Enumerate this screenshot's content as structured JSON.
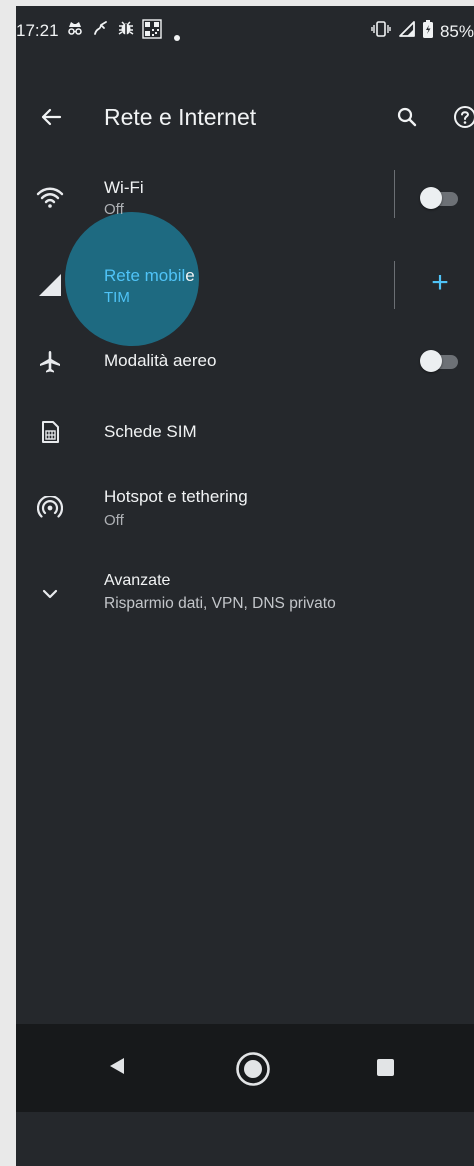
{
  "status_bar": {
    "time": "17:21",
    "battery_text": "85%",
    "left_icons": [
      "incognito-icon",
      "call-forward-icon",
      "bug-icon",
      "qr-icon",
      "dot-icon"
    ],
    "right_icons": [
      "vibrate-icon",
      "signal-icon",
      "battery-icon"
    ]
  },
  "app_bar": {
    "title": "Rete e Internet",
    "icons": [
      "back-arrow-icon",
      "search-icon",
      "help-icon"
    ]
  },
  "settings": [
    {
      "id": "wifi",
      "title": "Wi-Fi",
      "subtitle": "Off",
      "icon": "wifi-icon",
      "control": "toggle",
      "toggle_on": false
    },
    {
      "id": "mobile",
      "title_highlight": "Rete mobil",
      "title_rest": "e",
      "subtitle": "TIM",
      "icon": "cell-signal-icon",
      "control": "add",
      "control_text": "+"
    },
    {
      "id": "airplane",
      "title": "Modalità aereo",
      "icon": "airplane-icon",
      "control": "toggle",
      "toggle_on": false
    },
    {
      "id": "sim",
      "title": "Schede SIM",
      "icon": "sim-card-icon"
    },
    {
      "id": "hotspot",
      "title": "Hotspot e tethering",
      "subtitle": "Off",
      "icon": "hotspot-icon"
    },
    {
      "id": "advanced",
      "title": "Avanzate",
      "subtitle": "Risparmio dati, VPN, DNS privato",
      "icon": "chevron-down-icon"
    }
  ],
  "nav_bar": {
    "icons": [
      "nav-back-icon",
      "nav-home-icon",
      "nav-recents-icon"
    ]
  },
  "colors": {
    "background": "#25282c",
    "accent": "#4fc3f7",
    "ripple": "#1e6e86",
    "navbar": "#17191b",
    "text_primary": "#f1f3f4",
    "text_secondary": "#aeb1b5"
  }
}
